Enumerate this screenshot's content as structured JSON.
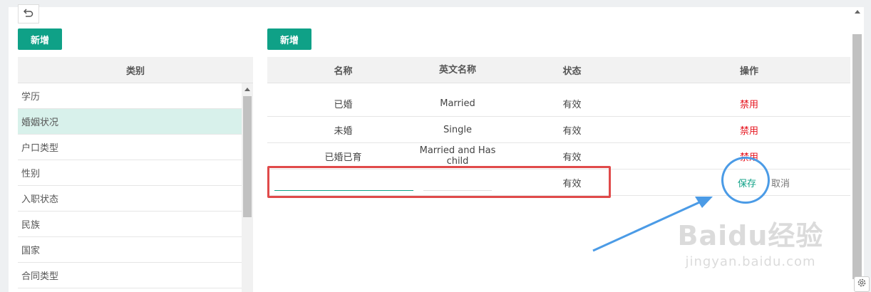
{
  "toolbar": {
    "back_icon": "undo-icon"
  },
  "left_panel": {
    "add_label": "新增",
    "header": "类别",
    "items": [
      {
        "label": "学历",
        "selected": false
      },
      {
        "label": "婚姻状况",
        "selected": true
      },
      {
        "label": "户口类型",
        "selected": false
      },
      {
        "label": "性别",
        "selected": false
      },
      {
        "label": "入职状态",
        "selected": false
      },
      {
        "label": "民族",
        "selected": false
      },
      {
        "label": "国家",
        "selected": false
      },
      {
        "label": "合同类型",
        "selected": false
      }
    ]
  },
  "right_panel": {
    "add_label": "新增",
    "columns": {
      "name": "名称",
      "english_name": "英文名称",
      "status": "状态",
      "actions": "操作"
    },
    "rows": [
      {
        "name": "已婚",
        "english_name": "Married",
        "status": "有效",
        "action": "禁用"
      },
      {
        "name": "未婚",
        "english_name": "Single",
        "status": "有效",
        "action": "禁用"
      },
      {
        "name": "已婚已育",
        "english_name": "Married and Has child",
        "status": "有效",
        "action": "禁用"
      }
    ],
    "edit_row": {
      "name_value": "",
      "english_name_value": "",
      "status": "有效",
      "save_label": "保存",
      "cancel_label": "取消"
    }
  },
  "watermark": {
    "main": "Baidu经验",
    "sub": "jingyan.baidu.com"
  },
  "colors": {
    "accent": "#0fa187",
    "danger": "#e5131d",
    "annotation_red": "#e04a4a",
    "annotation_blue": "#4b9be6"
  }
}
